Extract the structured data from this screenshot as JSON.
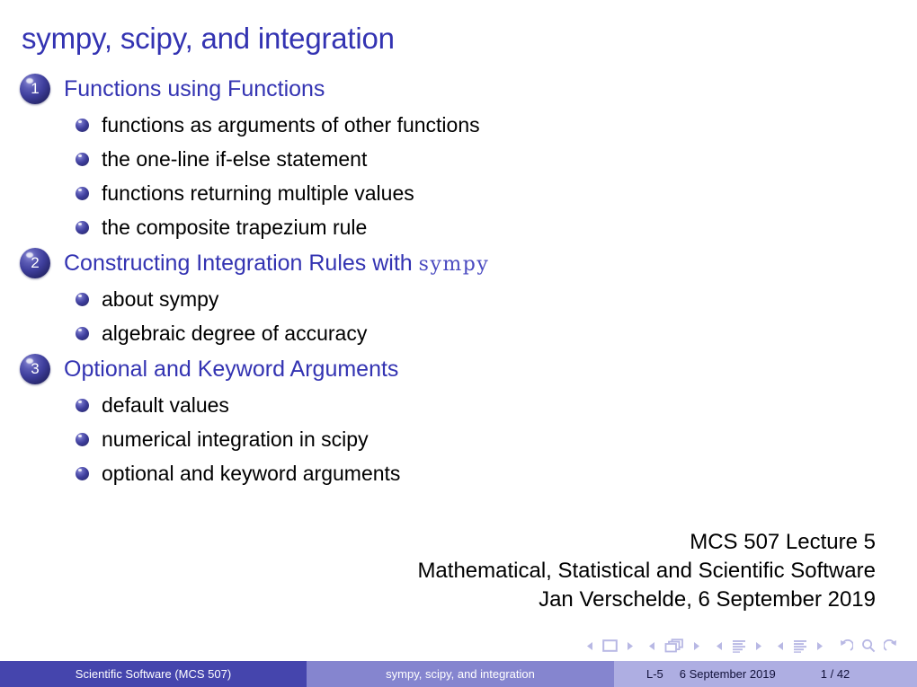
{
  "slide": {
    "title": "sympy, scipy, and integration",
    "sections": [
      {
        "number": "1",
        "title": "Functions using Functions",
        "title_mono": "",
        "items": [
          "functions as arguments of other functions",
          "the one-line if-else statement",
          "functions returning multiple values",
          "the composite trapezium rule"
        ]
      },
      {
        "number": "2",
        "title": "Constructing Integration Rules with ",
        "title_mono": "sympy",
        "items": [
          "about sympy",
          "algebraic degree of accuracy"
        ]
      },
      {
        "number": "3",
        "title": "Optional and Keyword Arguments",
        "title_mono": "",
        "items": [
          "default values",
          "numerical integration in scipy",
          "optional and keyword arguments"
        ]
      }
    ],
    "author_block": [
      "MCS 507 Lecture 5",
      "Mathematical, Statistical and Scientific Software",
      "Jan Verschelde, 6 September 2019"
    ],
    "navigation_symbols": [
      "prev-slide-icon",
      "slide-icon",
      "next-slide-icon",
      "prev-frame-icon",
      "frame-icon",
      "next-frame-icon",
      "prev-subsection-icon",
      "subsection-icon",
      "next-subsection-icon",
      "prev-section-icon",
      "section-icon",
      "next-section-icon",
      "back-icon",
      "search-icon",
      "forward-icon"
    ],
    "footer": {
      "left": "Scientific Software  (MCS 507)",
      "middle": "sympy, scipy, and integration",
      "lecture": "L-5",
      "date": "6 September 2019",
      "page": "1 / 42"
    },
    "colors": {
      "title_blue": "#3333b2",
      "body_black": "#000000",
      "footer_left_bg": "#4545ad",
      "footer_mid_bg": "#8585cf",
      "footer_right_bg": "#aeaee2",
      "nav_symbol": "#b8b8e4"
    }
  }
}
